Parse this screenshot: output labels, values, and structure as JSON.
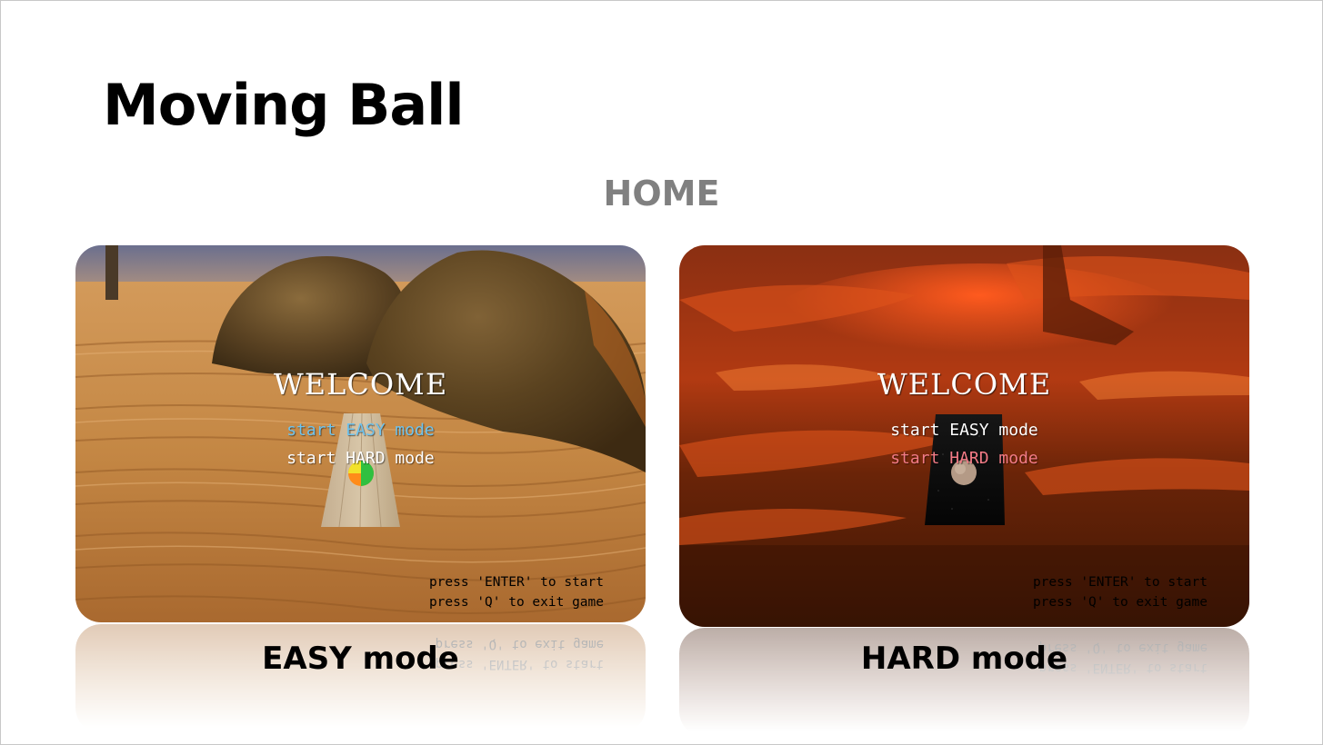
{
  "slide": {
    "title": "Moving Ball",
    "section_heading": "HOME"
  },
  "screens": [
    {
      "id": "easy",
      "welcome": "WELCOME",
      "menu_easy": "start EASY mode",
      "menu_hard": "start HARD mode",
      "selected": "easy",
      "hint_enter": "press 'ENTER' to start",
      "hint_quit": "press 'Q' to exit game",
      "caption": "EASY mode",
      "selected_color": "#6ec3ee",
      "normal_color": "#ffffff"
    },
    {
      "id": "hard",
      "welcome": "WELCOME",
      "menu_easy": "start EASY mode",
      "menu_hard": "start HARD mode",
      "selected": "hard",
      "hint_enter": "press 'ENTER' to start",
      "hint_quit": "press 'Q' to exit game",
      "caption": "HARD mode",
      "selected_color": "#f27b86",
      "normal_color": "#ffffff"
    }
  ]
}
